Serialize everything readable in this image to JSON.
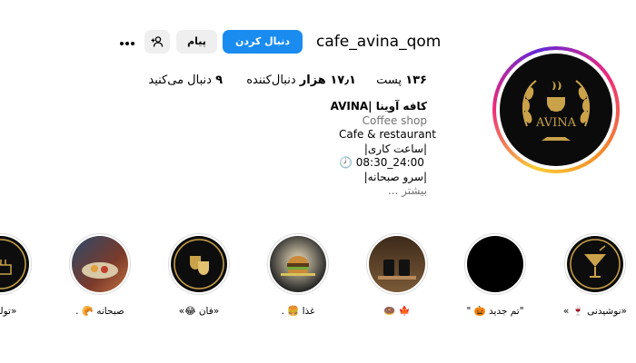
{
  "profile": {
    "username": "cafe_avina_qom",
    "follow_label": "دنبال کردن",
    "message_label": "پیام",
    "suggest_icon": "add-person-icon",
    "more_icon": "more-horizontal-icon",
    "avatar_logo_text": "AVINA"
  },
  "stats": {
    "posts_count": "۱۳۶",
    "posts_label": "پست",
    "followers_count": "۱۷٫۱ هزار",
    "followers_label": "دنبال‌کننده",
    "following_count": "۹",
    "following_label": "دنبال می‌کنید"
  },
  "bio": {
    "name": "کافه آوینا |AVINA",
    "category": "Coffee shop",
    "line1": "Cafe & restaurant",
    "line2": "|ساعت کاری|",
    "line3": "🕗 08:30_24:00",
    "line4": "|سرو صبحانه|",
    "more": "بیشتر ..."
  },
  "highlights": [
    {
      "label": "«نوشیدنی 🍷 »",
      "icon": "cocktail-icon"
    },
    {
      "label": "\"تم جدید 🎃 \"",
      "icon": "black-circle"
    },
    {
      "label": "🍁 🍩",
      "icon": "coffee-cups-photo"
    },
    {
      "label": "غذا 🍔 .",
      "icon": "burger-photo"
    },
    {
      "label": "«فان 😂»",
      "icon": "theater-masks-icon"
    },
    {
      "label": "صبحانه 🥐 .",
      "icon": "breakfast-photo"
    },
    {
      "label": "«تولداتو",
      "icon": "birthday-icon"
    }
  ],
  "colors": {
    "follow_button": "#1a8cf0",
    "secondary_button": "#efefef",
    "muted_text": "#737373",
    "logo_gold": "#c9a24a"
  }
}
